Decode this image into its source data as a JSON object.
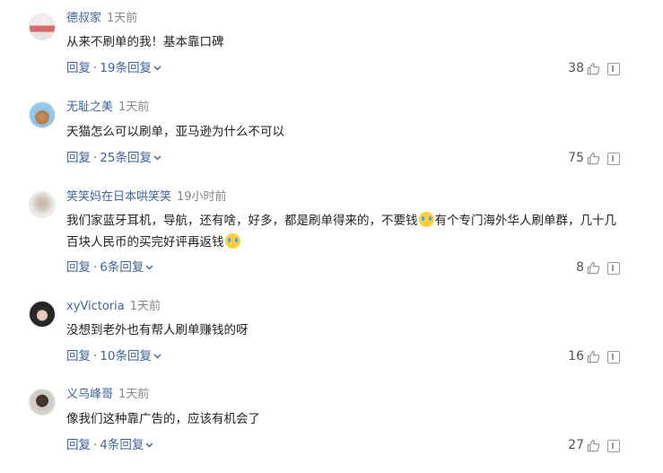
{
  "comments": [
    {
      "author": "德叔家",
      "time": "1天前",
      "content": "从来不刷单的我！基本靠口碑",
      "reply_label": "回复",
      "more_label": "19条回复",
      "likes": "38",
      "avatar_colors": [
        "#f0e8e6",
        "#d66"
      ]
    },
    {
      "author": "无耻之美",
      "time": "1天前",
      "content": "天猫怎么可以刷单，亚马逊为什么不可以",
      "reply_label": "回复",
      "more_label": "25条回复",
      "likes": "75",
      "avatar_colors": [
        "#8ec2e8",
        "#c89a5a"
      ]
    },
    {
      "author": "笑笑妈在日本哄笑笑",
      "time": "19小时前",
      "content_part1": "我们家蓝牙耳机，导航，还有啥，好多，都是刷单得来的，不要钱",
      "content_part2": "有个专门海外华人刷单群，几十几百块人民币的买完好评再返钱",
      "reply_label": "回复",
      "more_label": "6条回复",
      "likes": "8",
      "avatar_colors": [
        "#e8e4e0",
        "#bdb2a8"
      ]
    },
    {
      "author": "xyVictoria",
      "time": "1天前",
      "content": "没想到老外也有帮人刷单赚钱的呀",
      "reply_label": "回复",
      "more_label": "10条回复",
      "likes": "16",
      "avatar_colors": [
        "#2a2a2a",
        "#e8cfc6"
      ]
    },
    {
      "author": "义乌峰哥",
      "time": "1天前",
      "content": "像我们这种靠广告的，应该有机会了",
      "reply_label": "回复",
      "more_label": "4条回复",
      "likes": "27",
      "avatar_colors": [
        "#d9d4d0",
        "#3a3028"
      ]
    }
  ],
  "icons": {
    "like": "thumbs-up-icon",
    "report": "report-icon",
    "expand": "chevron-down-icon"
  },
  "colors": {
    "link": "#406599",
    "time": "#888888",
    "text": "#222222"
  }
}
